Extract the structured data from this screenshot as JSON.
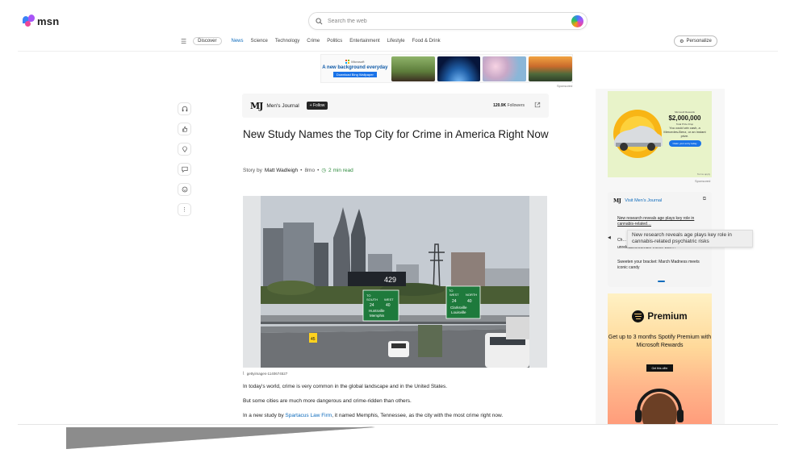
{
  "brand": {
    "logo_text": "msn"
  },
  "search": {
    "placeholder": "Search the web"
  },
  "nav": {
    "discover_label": "Discover",
    "items": [
      "News",
      "Science",
      "Technology",
      "Crime",
      "Politics",
      "Entertainment",
      "Lifestyle",
      "Food & Drink"
    ],
    "active": "News",
    "personalize_label": "Personalize"
  },
  "top_ad": {
    "brand": "Microsoft",
    "headline": "A new background everyday",
    "button_label": "Download Bing Wallpaper",
    "sponsored_label": "Sponsored"
  },
  "rail": {
    "icons": [
      "headphones-icon",
      "thumbs-up-icon",
      "dislike-icon",
      "comment-icon",
      "emoji-icon",
      "more-icon"
    ]
  },
  "publisher": {
    "logo": "MJ",
    "name": "Men's Journal",
    "follow_label": "+ Follow",
    "followers_count": "120.9K",
    "followers_label": "Followers"
  },
  "article": {
    "title": "New Study Names the Top City for Crime in America Right Now",
    "byline_prefix": "Story by",
    "author": "Matt Wadleigh",
    "age": "8mo",
    "read_time": "2 min read",
    "image_credit": "gettyimages-1140674527",
    "paragraphs": {
      "p1": "In today's world, crime is very common in the global landscape and in the United States.",
      "p2": "But some cities are much more dangerous and crime-ridden than others.",
      "p3_prefix": "In a new study by",
      "p3_link": "Spartacus Law Firm",
      "p3_suffix": ", it named Memphis, Tennessee, as the city with the most crime right now."
    },
    "sign_texts": {
      "billboard": "429",
      "left_sign": [
        "TO",
        "SOUTH",
        "WEST",
        "24",
        "40",
        "Huntsville",
        "Memphis"
      ],
      "right_sign": [
        "TO",
        "WEST",
        "NORTH",
        "24",
        "40",
        "Clarksville",
        "Louisville"
      ],
      "speed": "45"
    }
  },
  "right_ad": {
    "small_label": "Microsoft Rewards",
    "amount": "$2,000,000",
    "prize_label": "Total Prize Drop",
    "body": "You could win cash, a Mercedes-Benz, or an instant prize.",
    "button_label": "Claim your entry today",
    "terms": "Terms apply",
    "sponsored_label": "Sponsored"
  },
  "mj_card": {
    "logo": "MJ",
    "link_label": "Visit Men's Journal",
    "stories": [
      "New research reveals age plays key role in cannabis-related…",
      "Ch…",
      "unreleased zombie movie with…",
      "Sweeten your bracket: March Madness meets iconic candy"
    ]
  },
  "tooltip": {
    "text": "New research reveals age plays key role in cannabis-related psychiatric risks"
  },
  "spotify_ad": {
    "title": "Premium",
    "body": "Get up to 3 months Spotify Premium with Microsoft Rewards",
    "button_label": "Get this offer"
  },
  "colors": {
    "accent": "#0f6cbd",
    "read_time": "#2e8b3d",
    "follow_bg": "#262626"
  }
}
